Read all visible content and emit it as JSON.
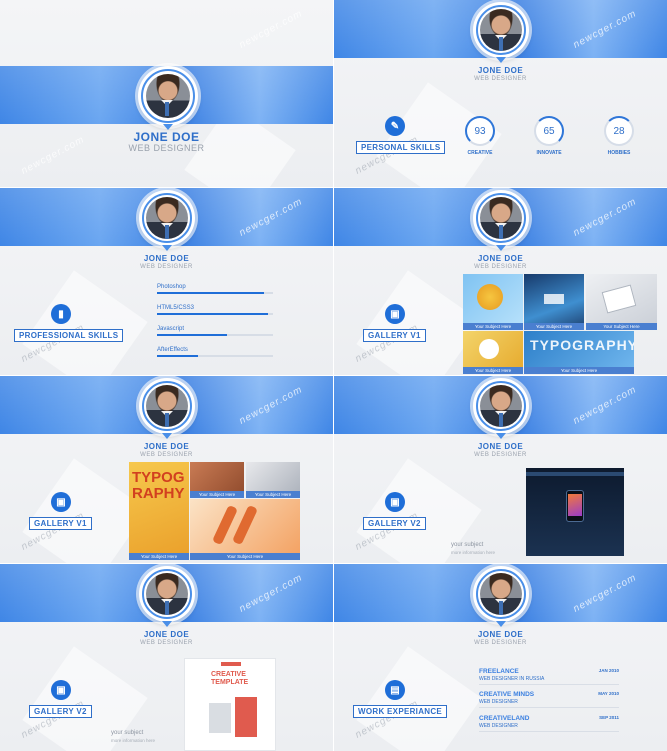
{
  "profile": {
    "name": "JONE DOE",
    "role": "WEB DESIGNER"
  },
  "watermark": "newcger.com",
  "personal_skills": {
    "label": "PERSONAL SKILLS",
    "stats": [
      {
        "value": "93",
        "label": "CREATIVE"
      },
      {
        "value": "65",
        "label": "INNOVATE"
      },
      {
        "value": "28",
        "label": "HOBBIES"
      }
    ]
  },
  "professional_skills": {
    "label": "PROFESSIONAL SKILLS",
    "skills": [
      {
        "name": "Photoshop",
        "level": 0.92
      },
      {
        "name": "HTML5/CSS3",
        "level": 0.96
      },
      {
        "name": "Javascript",
        "level": 0.6
      },
      {
        "name": "AfterEffects",
        "level": 0.35
      }
    ]
  },
  "gallery_v1": {
    "label": "GALLERY V1",
    "caption": "Your Subject Here"
  },
  "gallery_v2": {
    "label": "GALLERY V2",
    "subject": "your subject",
    "more_info": "more information here"
  },
  "mock": {
    "creative_template": "CREATIVE TEMPLATE",
    "typography": "TYPOGRAPHY"
  },
  "work_experience": {
    "label": "WORK EXPERIANCE",
    "items": [
      {
        "title": "FREELANCE",
        "subtitle": "WEB DESIGNER IN RUSSIA",
        "date": "JAN 2010"
      },
      {
        "title": "CREATIVE MINDS",
        "subtitle": "WEB DESIGNER",
        "date": "MAY 2010"
      },
      {
        "title": "CREATIVELAND",
        "subtitle": "WEB DESIGNER",
        "date": "SEP 2011"
      }
    ]
  }
}
